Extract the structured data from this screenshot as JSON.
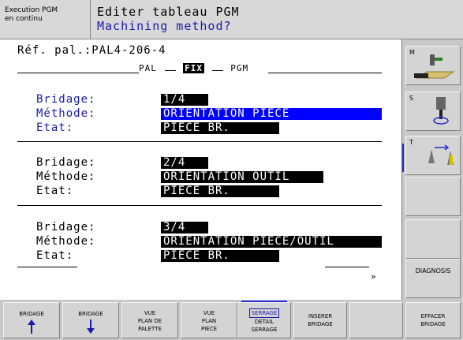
{
  "header": {
    "mode_line1": "Execution PGM",
    "mode_line2": "en continu",
    "title": "Editer tableau PGM",
    "prompt": "Machining method?"
  },
  "main": {
    "ref": "Réf. pal.:PAL4-206-4",
    "mode_pal": "PAL",
    "mode_fix": "FIX",
    "mode_pgm": "PGM",
    "labels": {
      "bridage": "Bridage:",
      "methode": "Méthode:",
      "etat": "Etat:"
    },
    "blocks": [
      {
        "bridage": "1/4",
        "methode": "ORIENTATION PIECE",
        "etat": "PIECE BR."
      },
      {
        "bridage": "2/4",
        "methode": "ORIENTATION OUTIL",
        "etat": "PIECE BR."
      },
      {
        "bridage": "3/4",
        "methode": "ORIENTATION PIECE/OUTIL",
        "etat": "PIECE BR."
      }
    ],
    "more_marker": "»"
  },
  "side": {
    "m_label": "M",
    "s_label": "S",
    "t_label": "T",
    "diagnosis": "DIAGNOSIS"
  },
  "softkeys": [
    {
      "line1": "BRIDAGE",
      "line2": "",
      "line3": "",
      "icon": "arrow-up-icon"
    },
    {
      "line1": "BRIDAGE",
      "line2": "",
      "line3": "",
      "icon": "arrow-down-icon"
    },
    {
      "line1": "VUE",
      "line2": "PLAN DE",
      "line3": "PALETTE"
    },
    {
      "line1": "VUE",
      "line2": "PLAN",
      "line3": "PIECE"
    },
    {
      "line1": "SERRAGE",
      "line2": "DETAIL",
      "line3": "SERRAGE"
    },
    {
      "line1": "INSERER",
      "line2": "BRIDAGE",
      "line3": ""
    },
    {
      "line1": "",
      "line2": "",
      "line3": ""
    },
    {
      "line1": "EFFACER",
      "line2": "BRIDAGE",
      "line3": ""
    }
  ],
  "colors": {
    "accent": "#1a1aa8",
    "selection": "#0000ff"
  }
}
